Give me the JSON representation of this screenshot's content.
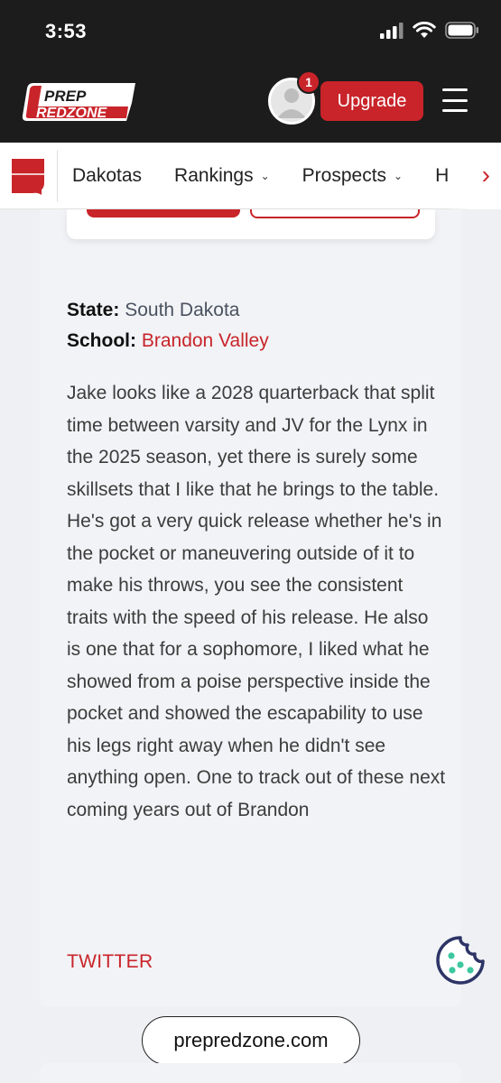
{
  "status_bar": {
    "time": "3:53"
  },
  "header": {
    "logo_line1": "PREP",
    "logo_line2": "REDZONE",
    "notification_count": "1",
    "upgrade_label": "Upgrade"
  },
  "subnav": {
    "items": [
      {
        "label": "Dakotas",
        "dropdown": false
      },
      {
        "label": "Rankings",
        "dropdown": true
      },
      {
        "label": "Prospects",
        "dropdown": true
      },
      {
        "label": "H",
        "dropdown": false
      }
    ],
    "caret": "⌄",
    "next_arrow": "›"
  },
  "article": {
    "state_label": "State:",
    "state_value": "South Dakota",
    "school_label": "School:",
    "school_value": "Brandon Valley",
    "body": "Jake looks like a 2028 quarterback that split time between varsity and JV for the Lynx in the 2025 season, yet there is surely some skillsets that I like that he brings to the table. He's got a very quick release whether he's in the pocket or maneuvering outside of it to make his throws, you see the consistent traits with the speed of his release. He also is one that for a sophomore, I liked what he showed from a poise perspective inside the pocket and showed the escapability to use his legs right away when he didn't see anything open. One to track out of these next coming years out of Brandon",
    "twitter_label": "TWITTER"
  },
  "browser": {
    "url": "prepredzone.com"
  },
  "colors": {
    "brand_red": "#c8242a",
    "header_bg": "#1c1c1c",
    "card_bg": "#f2f3f6",
    "cookie": "#2d3466",
    "cookie_dots": "#3ec7a0"
  },
  "icons": [
    "signal-icon",
    "wifi-icon",
    "battery-icon",
    "avatar-icon",
    "menu-icon",
    "south-dakota-icon",
    "chevron-right-icon",
    "cookie-icon"
  ]
}
